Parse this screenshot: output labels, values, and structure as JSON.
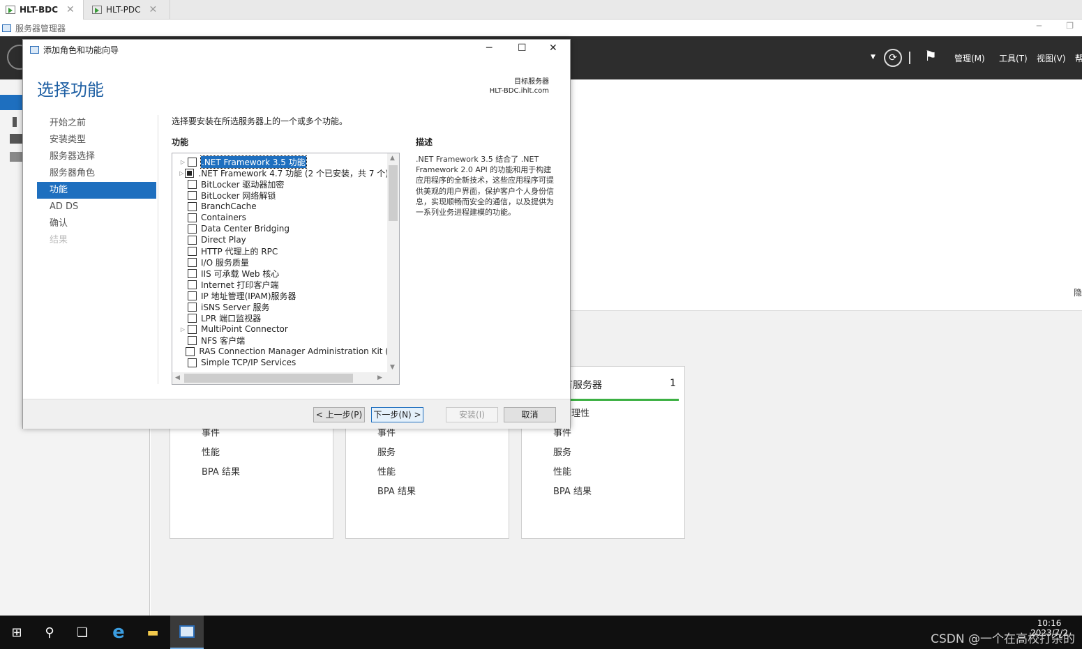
{
  "vm_tabs": [
    {
      "label": "HLT-BDC"
    },
    {
      "label": "HLT-PDC"
    }
  ],
  "server_manager": {
    "title": "服务器管理器",
    "menus": [
      "管理(M)",
      "工具(T)",
      "视图(V)",
      "帮"
    ],
    "right_edge_text": "隐"
  },
  "tiles": [
    {
      "items": [
        "事件",
        "性能",
        "BPA 结果"
      ]
    },
    {
      "items": [
        "事件",
        "服务",
        "性能",
        "BPA 结果"
      ]
    },
    {
      "header": "所有服务器",
      "count": "1",
      "items": [
        "可管理性",
        "事件",
        "服务",
        "性能",
        "BPA 结果"
      ]
    }
  ],
  "dialog": {
    "title": "添加角色和功能向导",
    "heading": "选择功能",
    "target_label": "目标服务器",
    "target_server": "HLT-BDC.ihlt.com",
    "steps": [
      {
        "label": "开始之前",
        "state": "normal"
      },
      {
        "label": "安装类型",
        "state": "normal"
      },
      {
        "label": "服务器选择",
        "state": "normal"
      },
      {
        "label": "服务器角色",
        "state": "normal"
      },
      {
        "label": "功能",
        "state": "active"
      },
      {
        "label": "AD DS",
        "state": "normal"
      },
      {
        "label": "确认",
        "state": "normal"
      },
      {
        "label": "结果",
        "state": "disabled"
      }
    ],
    "instruction": "选择要安装在所选服务器上的一个或多个功能。",
    "features_label": "功能",
    "description_label": "描述",
    "description_text": ".NET Framework 3.5 结合了 .NET Framework 2.0 API 的功能和用于构建应用程序的全新技术，这些应用程序可提供美观的用户界面，保护客户个人身份信息，实现顺畅而安全的通信，以及提供为一系列业务进程建模的功能。",
    "features": [
      {
        "label": ".NET Framework 3.5 功能",
        "expandable": true,
        "checked": "none",
        "selected": true
      },
      {
        "label": ".NET Framework 4.7 功能 (2 个已安装，共 7 个)",
        "expandable": true,
        "checked": "partial",
        "selected": false
      },
      {
        "label": "BitLocker 驱动器加密",
        "expandable": false,
        "checked": "none",
        "selected": false
      },
      {
        "label": "BitLocker 网络解锁",
        "expandable": false,
        "checked": "none",
        "selected": false
      },
      {
        "label": "BranchCache",
        "expandable": false,
        "checked": "none",
        "selected": false
      },
      {
        "label": "Containers",
        "expandable": false,
        "checked": "none",
        "selected": false
      },
      {
        "label": "Data Center Bridging",
        "expandable": false,
        "checked": "none",
        "selected": false
      },
      {
        "label": "Direct Play",
        "expandable": false,
        "checked": "none",
        "selected": false
      },
      {
        "label": "HTTP 代理上的 RPC",
        "expandable": false,
        "checked": "none",
        "selected": false
      },
      {
        "label": "I/O 服务质量",
        "expandable": false,
        "checked": "none",
        "selected": false
      },
      {
        "label": "IIS 可承载 Web 核心",
        "expandable": false,
        "checked": "none",
        "selected": false
      },
      {
        "label": "Internet 打印客户端",
        "expandable": false,
        "checked": "none",
        "selected": false
      },
      {
        "label": "IP 地址管理(IPAM)服务器",
        "expandable": false,
        "checked": "none",
        "selected": false
      },
      {
        "label": "iSNS Server 服务",
        "expandable": false,
        "checked": "none",
        "selected": false
      },
      {
        "label": "LPR 端口监视器",
        "expandable": false,
        "checked": "none",
        "selected": false
      },
      {
        "label": "MultiPoint Connector",
        "expandable": true,
        "checked": "none",
        "selected": false
      },
      {
        "label": "NFS 客户端",
        "expandable": false,
        "checked": "none",
        "selected": false
      },
      {
        "label": "RAS Connection Manager Administration Kit (",
        "expandable": false,
        "checked": "none",
        "selected": false
      },
      {
        "label": "Simple TCP/IP Services",
        "expandable": false,
        "checked": "none",
        "selected": false
      }
    ],
    "buttons": {
      "prev": "< 上一步(P)",
      "next": "下一步(N) >",
      "install": "安装(I)",
      "cancel": "取消"
    }
  },
  "taskbar": {
    "time": "10:16",
    "date": "2023/7/2"
  },
  "watermark": "CSDN @一个在高校打杂的"
}
